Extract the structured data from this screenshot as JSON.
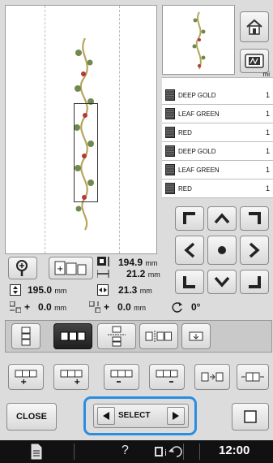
{
  "thread_list": {
    "header": "mi",
    "threads": [
      {
        "name": "DEEP GOLD",
        "count": "1"
      },
      {
        "name": "LEAF GREEN",
        "count": "1"
      },
      {
        "name": "RED",
        "count": "1"
      },
      {
        "name": "DEEP GOLD",
        "count": "1"
      },
      {
        "name": "LEAF GREEN",
        "count": "1"
      },
      {
        "name": "RED",
        "count": "1"
      }
    ]
  },
  "size": {
    "height_value": "194.9",
    "height_unit": "mm",
    "width_value": "21.2",
    "width_unit": "mm"
  },
  "measurements": {
    "total_height": "195.0",
    "total_height_unit": "mm",
    "total_width": "21.3",
    "total_width_unit": "mm",
    "offset_x_sign": "+",
    "offset_x": "0.0",
    "offset_x_unit": "mm",
    "offset_y_sign": "+",
    "offset_y": "0.0",
    "offset_y_unit": "mm",
    "rotation": "0°"
  },
  "buttons": {
    "close_label": "CLOSE",
    "select_label": "SELECT"
  },
  "status_bar": {
    "help_label": "?",
    "time": "12:00"
  },
  "colors": {
    "highlight": "#2a8ee0",
    "screen_bg": "#dcdcdc",
    "status_bar": "#111111"
  }
}
